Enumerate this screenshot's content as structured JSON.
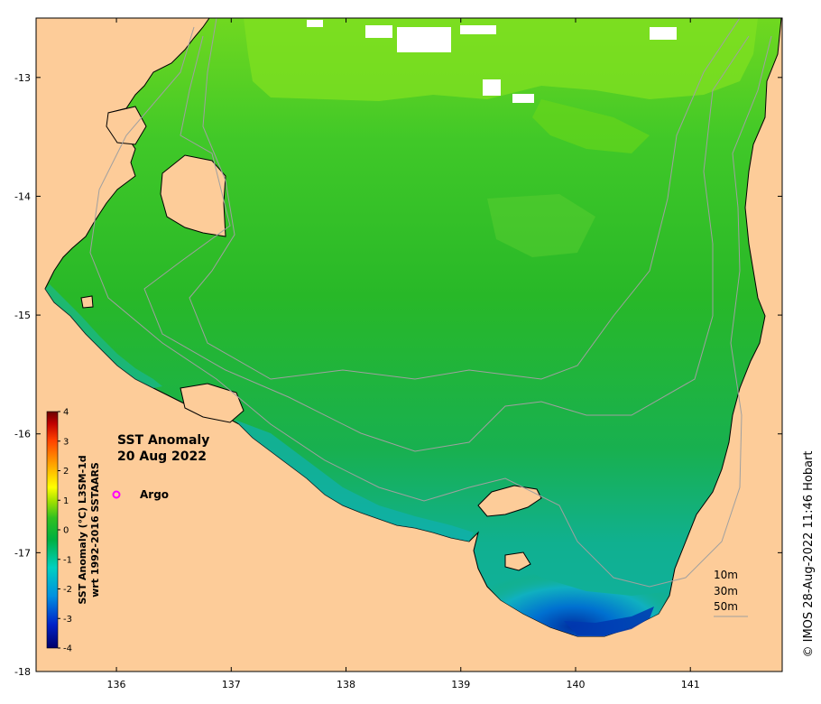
{
  "title": {
    "line1": "SST Anomaly",
    "line2": "20 Aug 2022"
  },
  "legend": {
    "argo_label": "Argo",
    "argo_color": "#ff00ff"
  },
  "colorbar": {
    "title_line1": "SST Anomaly (°C) L3SM-1d",
    "title_line2": "wrt 1992-2016 SSTAARS",
    "ticks": [
      "4",
      "3",
      "2",
      "1",
      "0",
      "-1",
      "-2",
      "-3",
      "-4"
    ],
    "tick_values": [
      4,
      3,
      2,
      1,
      0,
      -1,
      -2,
      -3,
      -4
    ],
    "range": [
      -4,
      4
    ],
    "colors": [
      "#00006a",
      "#0022c8",
      "#0090e0",
      "#00d0c0",
      "#00b040",
      "#30c020",
      "#a0e000",
      "#ffff00",
      "#ffa000",
      "#ff4000",
      "#c00000",
      "#6a0000"
    ]
  },
  "axes": {
    "x_ticks": [
      "136",
      "137",
      "138",
      "139",
      "140",
      "141"
    ],
    "x_values": [
      136,
      137,
      138,
      139,
      140,
      141
    ],
    "y_ticks": [
      "-13",
      "-14",
      "-15",
      "-16",
      "-17",
      "-18"
    ],
    "y_values": [
      -13,
      -14,
      -15,
      -16,
      -17,
      -18
    ],
    "x_range": [
      135.3,
      141.8
    ],
    "y_range": [
      -18,
      -12.5
    ]
  },
  "depth_legend": {
    "items": [
      "10m",
      "30m",
      "50m"
    ]
  },
  "credit": "© IMOS 28-Aug-2022 11:46 Hobart",
  "colors": {
    "land": "#fdcc99",
    "sea_main": "#28b828",
    "sea_north": "#70d820",
    "sea_cold": "#1a9ae0",
    "sea_very_cold": "#0030a0",
    "contour": "#a0a0a0"
  }
}
